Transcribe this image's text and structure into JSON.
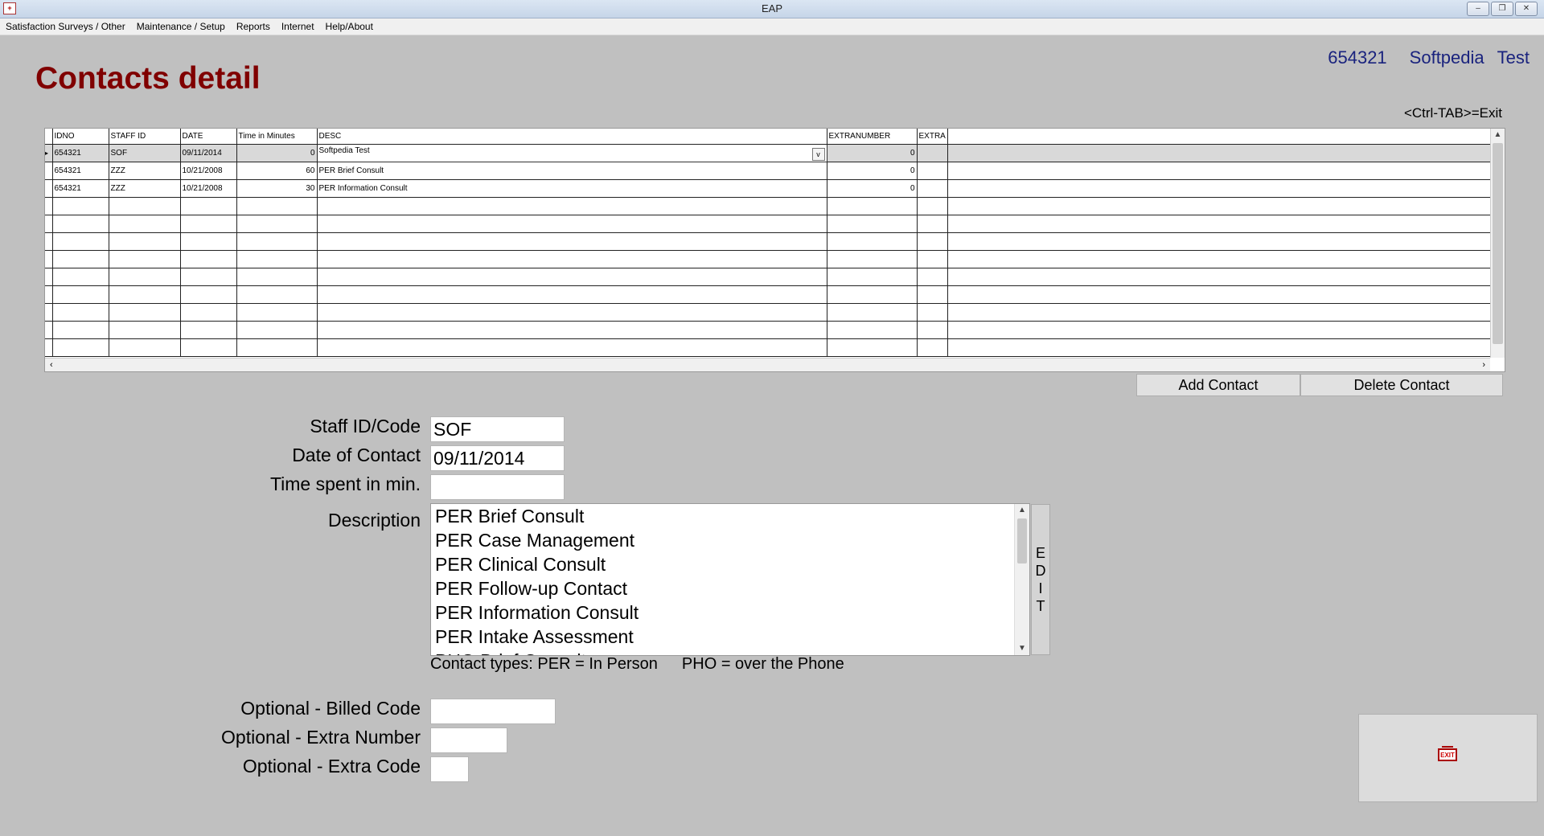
{
  "window": {
    "title": "EAP",
    "icon_label": "+",
    "buttons": {
      "minimize": "–",
      "restore": "❐",
      "close": "✕"
    }
  },
  "menubar": {
    "items": [
      "Satisfaction Surveys / Other",
      "Maintenance / Setup",
      "Reports",
      "Internet",
      "Help/About"
    ]
  },
  "header": {
    "page_title": "Contacts detail",
    "client_id": "654321",
    "client_first": "Softpedia",
    "client_last": "Test",
    "exit_hint": "<Ctrl-TAB>=Exit"
  },
  "grid": {
    "columns": [
      "IDNO",
      "STAFF ID",
      "DATE",
      "Time in Minutes",
      "DESC",
      "EXTRANUMBER",
      "EXTRA"
    ],
    "rows": [
      {
        "idno": "654321",
        "staff": "SOF",
        "date": "09/11/2014",
        "time": "0",
        "desc": "Softpedia Test",
        "extranumber": "0",
        "extra": ""
      },
      {
        "idno": "654321",
        "staff": "ZZZ",
        "date": "10/21/2008",
        "time": "60",
        "desc": "PER Brief Consult",
        "extranumber": "0",
        "extra": ""
      },
      {
        "idno": "654321",
        "staff": "ZZZ",
        "date": "10/21/2008",
        "time": "30",
        "desc": "PER Information Consult",
        "extranumber": "0",
        "extra": ""
      }
    ],
    "empty_rows": 9,
    "current_row_marker": "▸",
    "dropdown_arrow": "v"
  },
  "actions": {
    "add_contact": "Add Contact",
    "delete_contact": "Delete Contact"
  },
  "form": {
    "staff_label": "Staff ID/Code",
    "staff_value": "SOF",
    "date_label": "Date of Contact",
    "date_value": "09/11/2014",
    "time_label": "Time spent in min.",
    "time_value": "",
    "description_label": "Description",
    "description_options": [
      "PER Brief Consult",
      "PER Case Management",
      "PER Clinical Consult",
      "PER Follow-up Contact",
      "PER Information Consult",
      "PER Intake Assessment",
      "PHO Brief Consult"
    ],
    "edit_letters": [
      "E",
      "D",
      "I",
      "T"
    ],
    "contact_types_per": "Contact types: PER = In Person",
    "contact_types_pho": "PHO = over the Phone",
    "billed_label": "Optional - Billed Code",
    "billed_value": "",
    "extra_number_label": "Optional - Extra Number",
    "extra_number_value": "",
    "extra_code_label": "Optional - Extra Code",
    "extra_code_value": ""
  },
  "exit": {
    "sign_text": "EXIT",
    "icon": "exit-sign-icon"
  },
  "colors": {
    "title": "#800000",
    "client": "#1a237e",
    "background": "#c0c0c0"
  }
}
